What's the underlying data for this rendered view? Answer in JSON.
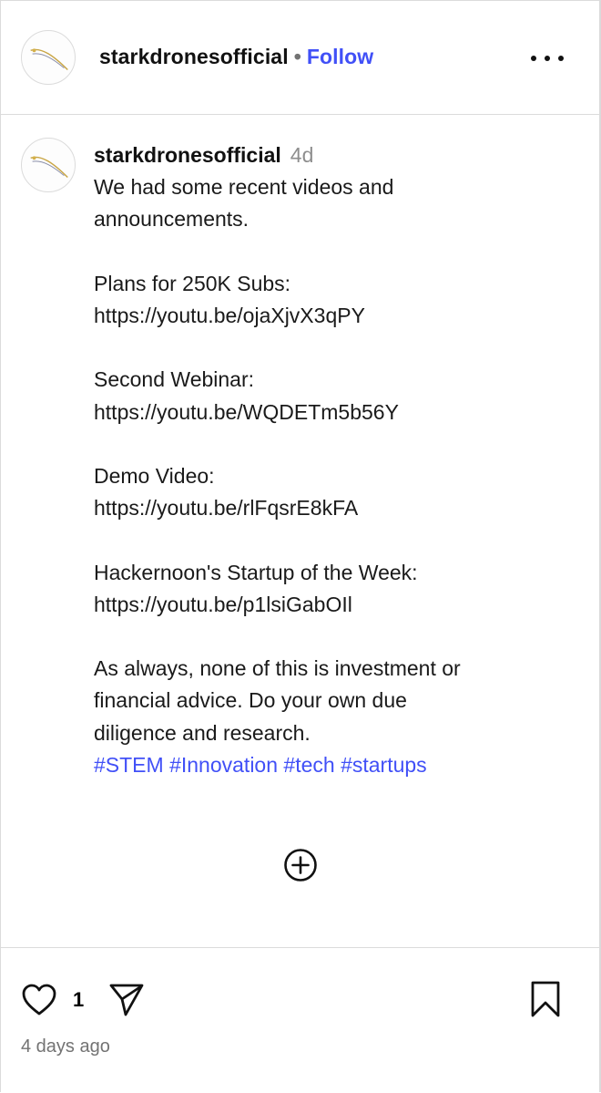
{
  "header": {
    "username": "starkdronesofficial",
    "separator": "•",
    "follow_label": "Follow",
    "more_icon": "more-horizontal-icon"
  },
  "caption": {
    "username": "starkdronesofficial",
    "time": "4d",
    "lines": [
      "We had some recent videos and",
      "announcements.",
      "",
      "Plans for 250K Subs:",
      "https://youtu.be/ojaXjvX3qPY",
      "",
      "Second Webinar:",
      "https://youtu.be/WQDETm5b56Y",
      "",
      "Demo Video:",
      "https://youtu.be/rlFqsrE8kFA",
      "",
      "Hackernoon's Startup of the Week:",
      "https://youtu.be/p1lsiGabOIl",
      "",
      "As always, none of this is investment or",
      "financial advice. Do your own due",
      "diligence and research."
    ],
    "hashtags": [
      "#STEM",
      "#Innovation",
      "#tech",
      "#startups"
    ]
  },
  "load_more_icon": "plus-circle-icon",
  "actions": {
    "like_icon": "heart-icon",
    "like_count": "1",
    "share_icon": "send-icon",
    "save_icon": "bookmark-icon",
    "timestamp": "4 days ago"
  },
  "colors": {
    "link": "#4150f7",
    "border": "#dbdbdb",
    "muted": "#737373"
  }
}
